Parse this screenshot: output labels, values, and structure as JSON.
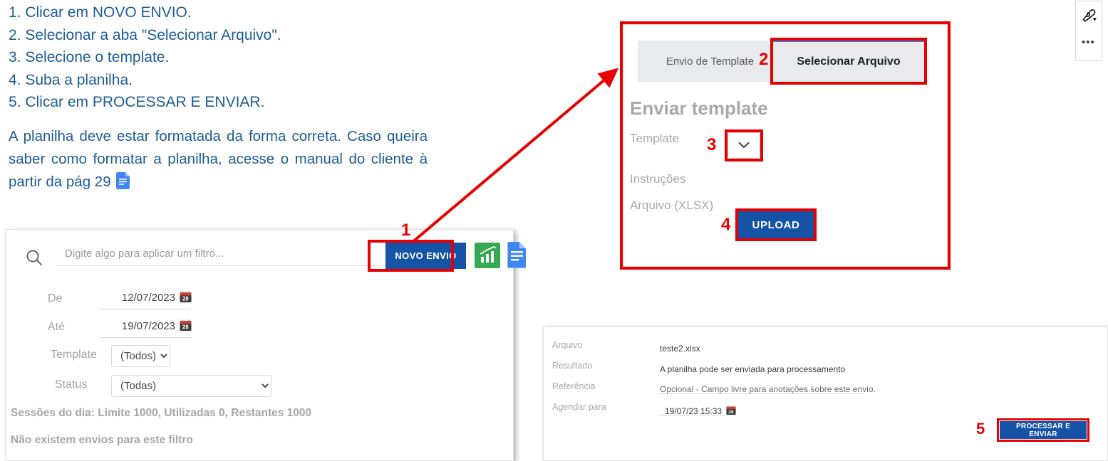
{
  "instructions": {
    "steps": [
      "1. Clicar em NOVO ENVIO.",
      "2. Selecionar a aba \"Selecionar Arquivo\".",
      "3. Selecione o template.",
      "4. Suba a planilha.",
      "5. Clicar em PROCESSAR E ENVIAR."
    ],
    "paragraph": "A planilha deve estar formatada da forma correta. Caso queira saber como formatar a planilha, acesse o manual do cliente à partir da pág 29",
    "doc_icon": "google-docs-icon"
  },
  "colors": {
    "instruction_text": "#1d5c96",
    "highlight_red": "#e60000",
    "primary_blue": "#1653a6",
    "green_icon": "#34a853",
    "doc_blue": "#4285f4",
    "tab_bg": "#e8eaed",
    "muted_label": "#a8a8a8"
  },
  "step_numbers": {
    "one": "1",
    "two": "2",
    "three": "3",
    "four": "4",
    "five": "5"
  },
  "filter_panel": {
    "search": {
      "placeholder": "Digite algo para aplicar um filtro...",
      "value": "",
      "icon": "search-icon"
    },
    "new_submission_button": "NOVO ENVIO",
    "chart_icon": "bar-chart-icon",
    "doc_icon": "document-list-icon",
    "fields": [
      {
        "label": "De",
        "value": "12/07/2023",
        "icon": "calendar-icon"
      },
      {
        "label": "Até",
        "value": "19/07/2023",
        "icon": "calendar-icon"
      }
    ],
    "template_select": {
      "label": "Template",
      "value": "(Todos)",
      "options": [
        "(Todos)"
      ]
    },
    "status_select": {
      "label": "Status",
      "value": "(Todas)",
      "options": [
        "(Todas)"
      ]
    },
    "sessions_text": "Sessões do dia: Limite 1000, Utilizadas 0, Restantes 1000",
    "empty_text": "Não existem envios para este filtro"
  },
  "template_panel": {
    "tabs": [
      {
        "label": "Envio de Template",
        "active": false
      },
      {
        "label": "Selecionar Arquivo",
        "active": true
      }
    ],
    "title": "Enviar template",
    "template_label": "Template",
    "template_select_value": "",
    "template_select_icon": "chevron-down-icon",
    "instructions_label": "Instruções",
    "file_label": "Arquivo (XLSX)",
    "upload_button": "UPLOAD"
  },
  "detail_panel": {
    "rows": [
      {
        "label": "Arquivo",
        "value": "teste2.xlsx"
      },
      {
        "label": "Resultado",
        "value": "A planilha pode ser enviada para processamento"
      },
      {
        "label": "Referência",
        "value": "Opcional - Campo livre para anotações sobre este envio."
      },
      {
        "label": "Agendar para",
        "value": "19/07/23 15:33",
        "icon": "calendar-icon"
      }
    ],
    "submit_button": "PROCESSAR E ENVIAR"
  },
  "floating_toolbar": {
    "pen_icon": "pen-highlighter-icon",
    "more_label": "•••"
  }
}
